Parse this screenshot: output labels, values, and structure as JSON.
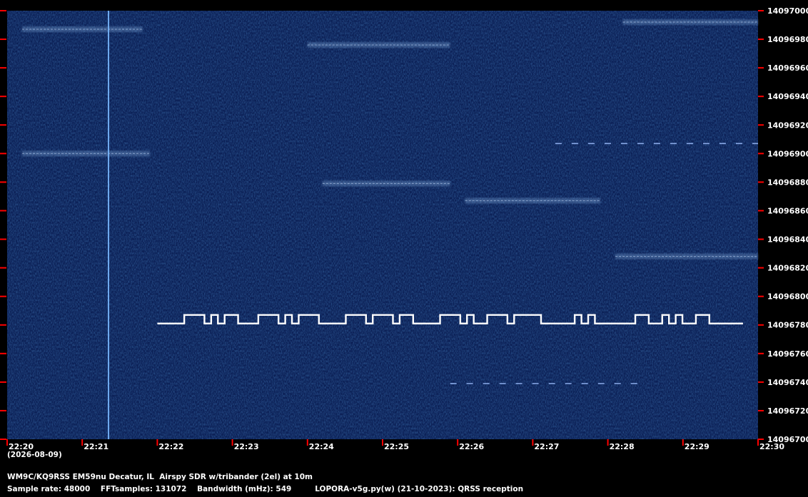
{
  "chart_data": {
    "type": "heatmap",
    "title": "",
    "xlabel": "",
    "ylabel": "",
    "x_ticks": [
      "22:20",
      "22:21",
      "22:22",
      "22:23",
      "22:24",
      "22:25",
      "22:26",
      "22:27",
      "22:28",
      "22:29",
      "22:30"
    ],
    "x_range_minutes": [
      0,
      10
    ],
    "y_ticks": [
      14096700,
      14096720,
      14096740,
      14096760,
      14096780,
      14096800,
      14096820,
      14096840,
      14096860,
      14096880,
      14096900,
      14096920,
      14096940,
      14096960,
      14096980,
      14097000
    ],
    "y_range_hz": [
      14096700,
      14097000
    ],
    "date_label": "(2026-08-09)",
    "colors": {
      "background": "#0b1f55",
      "signal": "#ffffff",
      "tick": "#ff0000",
      "faint": "#7fa7d8"
    },
    "traces": [
      {
        "kind": "carrier",
        "freq_hz": 14096781,
        "start": "22:22",
        "end": "22:29.8",
        "shift_hz": 4,
        "pattern": [
          0,
          0,
          0,
          0,
          1,
          1,
          1,
          0,
          1,
          0,
          1,
          1,
          0,
          0,
          0,
          1,
          1,
          1,
          0,
          1,
          0,
          1,
          1,
          1,
          0,
          0,
          0,
          0,
          1,
          1,
          1,
          0,
          1,
          1,
          1,
          0,
          1,
          1,
          0,
          0,
          0,
          0,
          1,
          1,
          1,
          0,
          1,
          0,
          0,
          1,
          1,
          1,
          0,
          1,
          1,
          1,
          1,
          0,
          0,
          0,
          0,
          0,
          1,
          0,
          1,
          0,
          0,
          0,
          0,
          0,
          0,
          1,
          1,
          0,
          0,
          1,
          0,
          1,
          0,
          0,
          1,
          1,
          0,
          0,
          0,
          0,
          0
        ]
      },
      {
        "kind": "dashes",
        "freq_hz": 14096907,
        "start": "22:27.3",
        "end": "22:30"
      },
      {
        "kind": "dashes",
        "freq_hz": 14096739,
        "start": "22:25.9",
        "end": "22:28.5"
      },
      {
        "kind": "band",
        "freq_hz": 14096976,
        "start": "22:24",
        "end": "22:25.9"
      },
      {
        "kind": "band",
        "freq_hz": 14096987,
        "start": "22:20.2",
        "end": "22:21.8"
      },
      {
        "kind": "band",
        "freq_hz": 14096900,
        "start": "22:20.2",
        "end": "22:21.9"
      },
      {
        "kind": "band",
        "freq_hz": 14096879,
        "start": "22:24.2",
        "end": "22:25.9"
      },
      {
        "kind": "band",
        "freq_hz": 14096867,
        "start": "22:26.1",
        "end": "22:27.9"
      },
      {
        "kind": "band",
        "freq_hz": 14096828,
        "start": "22:28.1",
        "end": "22:30"
      },
      {
        "kind": "band",
        "freq_hz": 14096992,
        "start": "22:28.2",
        "end": "22:30"
      },
      {
        "kind": "vline",
        "at": "22:21.35"
      }
    ]
  },
  "footer": {
    "line1": "WM9C/KQ9RSS EM59nu Decatur, IL  Airspy SDR w/tribander (2el) at 10m",
    "line2": "Sample rate: 48000    FFTsamples: 131072    Bandwidth (mHz): 549         LOPORA-v5g.py(w) (21-10-2023): QRSS reception"
  }
}
